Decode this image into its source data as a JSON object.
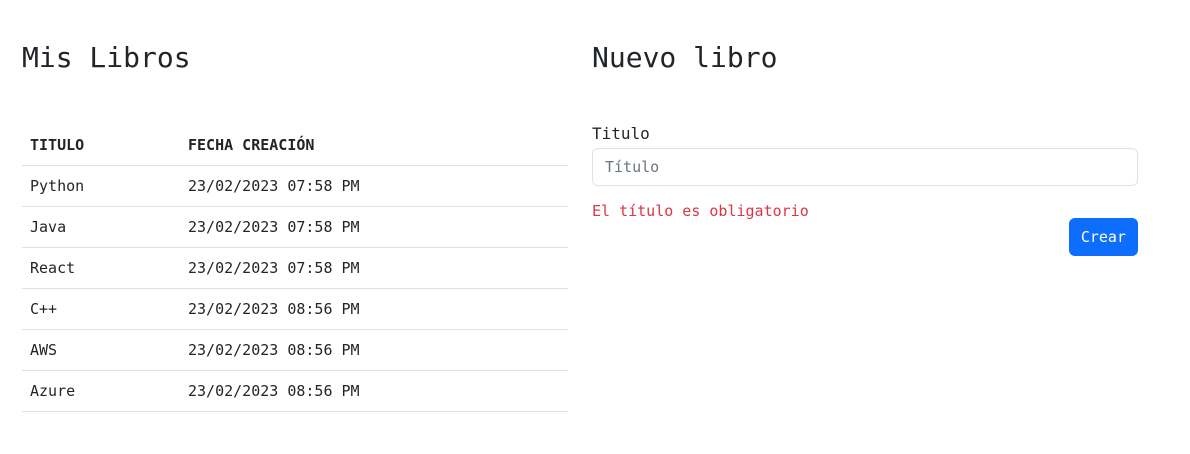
{
  "books": {
    "title": "Mis Libros",
    "columns": [
      "TITULO",
      "FECHA CREACIÓN"
    ],
    "rows": [
      {
        "title": "Python",
        "date": "23/02/2023 07:58 PM"
      },
      {
        "title": "Java",
        "date": "23/02/2023 07:58 PM"
      },
      {
        "title": "React",
        "date": "23/02/2023 07:58 PM"
      },
      {
        "title": "C++",
        "date": "23/02/2023 08:56 PM"
      },
      {
        "title": "AWS",
        "date": "23/02/2023 08:56 PM"
      },
      {
        "title": "Azure",
        "date": "23/02/2023 08:56 PM"
      }
    ]
  },
  "form": {
    "title": "Nuevo libro",
    "label": "Titulo",
    "placeholder": "Título",
    "value": "",
    "error": "El título es obligatorio",
    "submit_label": "Crear"
  },
  "colors": {
    "primary": "#0d6efd",
    "danger": "#dc3545",
    "text": "#212529",
    "border": "#dee2e6"
  }
}
